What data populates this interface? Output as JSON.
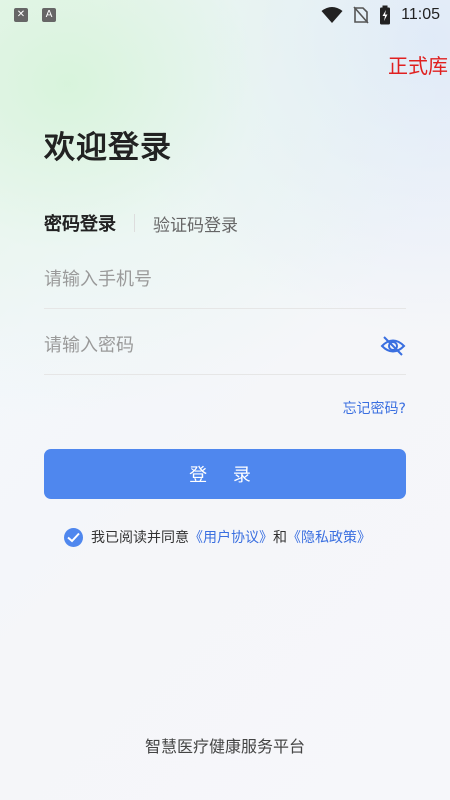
{
  "status_bar": {
    "time": "11:05"
  },
  "env_tag": "正式库",
  "title": "欢迎登录",
  "tabs": {
    "password_login": "密码登录",
    "sms_login": "验证码登录"
  },
  "phone_input": {
    "placeholder": "请输入手机号",
    "value": ""
  },
  "password_input": {
    "placeholder": "请输入密码",
    "value": ""
  },
  "forgot_password": "忘记密码?",
  "login_button": "登 录",
  "agreement": {
    "checked": true,
    "prefix": "我已阅读并同意",
    "user_agreement": "《用户协议》",
    "and": "和",
    "privacy_policy": "《隐私政策》"
  },
  "footer": "智慧医疗健康服务平台",
  "colors": {
    "accent": "#4f87ee",
    "link": "#3a6fe0",
    "env_tag": "#e02020"
  },
  "icons": [
    "shield-icon",
    "font-a-icon",
    "wifi-icon",
    "no-sim-icon",
    "battery-charging-icon",
    "eye-off-icon",
    "check-icon"
  ]
}
